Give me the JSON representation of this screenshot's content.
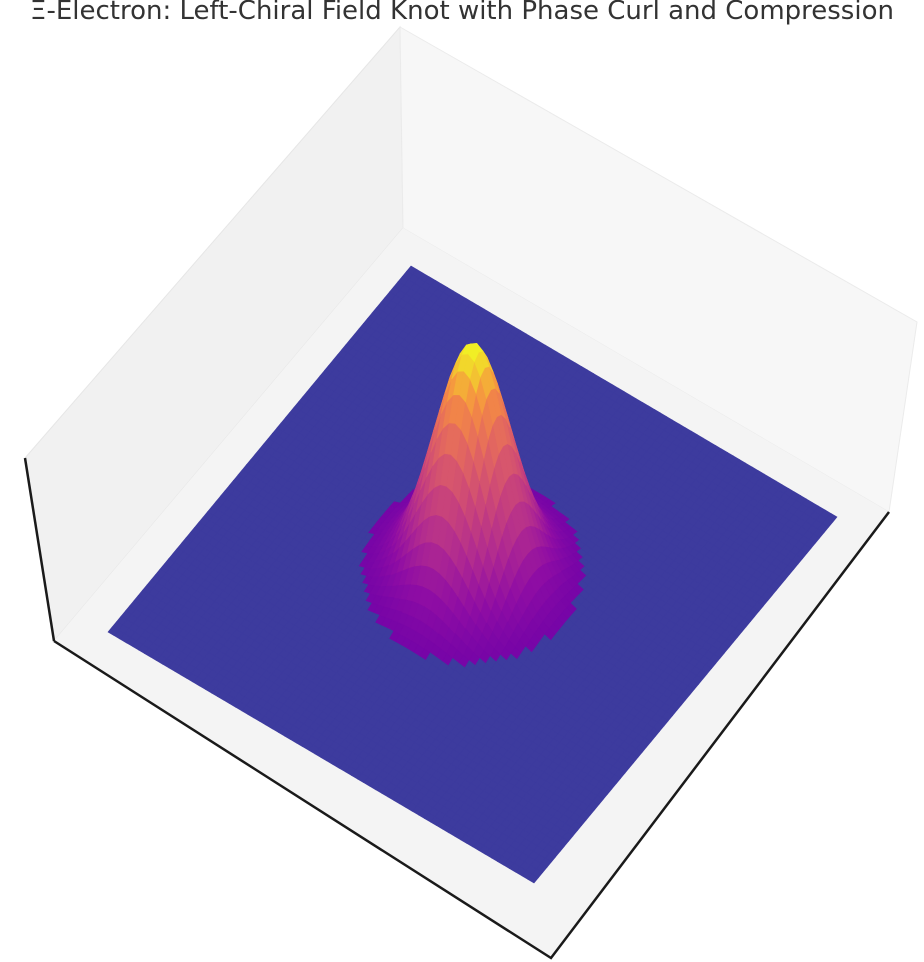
{
  "chart_data": {
    "type": "surface",
    "title": "Ξ-Electron: Left-Chiral Field Knot with Phase Curl and Compression",
    "xlabel": "",
    "ylabel": "",
    "zlabel": "",
    "colormap": "plasma",
    "grid": false,
    "axis_ticks_visible": false,
    "surface": {
      "description_fn": "z = A * exp(-(x^2 + y^2) / w)",
      "amplitude": 1.0,
      "baseline": 0.0,
      "x_range": [
        -1,
        1
      ],
      "y_range": [
        -1,
        1
      ],
      "peak_location": [
        0.0,
        0.0
      ]
    },
    "colors": {
      "pane_back_left": "#f1f1f1",
      "pane_back_right": "#f7f7f7",
      "pane_floor": "#f4f4f4",
      "axis_line": "#1a1a1a",
      "base_surface": "#3d3b9e",
      "peak": "#f0e030"
    }
  }
}
